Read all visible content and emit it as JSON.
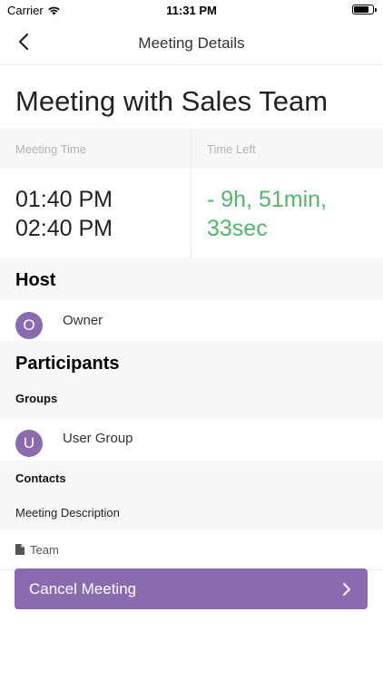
{
  "status_bar": {
    "carrier": "Carrier",
    "time": "11:31 PM"
  },
  "nav": {
    "title": "Meeting Details"
  },
  "meeting": {
    "title": "Meeting with Sales Team",
    "time_label": "Meeting Time",
    "time_left_label": "Time Left",
    "start_time": "01:40 PM",
    "end_time": "02:40 PM",
    "time_left_line1": "- 9h, 51min,",
    "time_left_line2": "33sec"
  },
  "host": {
    "section_title": "Host",
    "initial": "O",
    "name": "Owner"
  },
  "participants": {
    "section_title": "Participants",
    "groups_label": "Groups",
    "group": {
      "initial": "U",
      "name": "User Group"
    },
    "contacts_label": "Contacts"
  },
  "description": {
    "label": "Meeting Description",
    "file_name": "Team"
  },
  "actions": {
    "cancel_label": "Cancel Meeting"
  },
  "colors": {
    "accent": "#8a6bb0",
    "time_left": "#4fb86a"
  }
}
